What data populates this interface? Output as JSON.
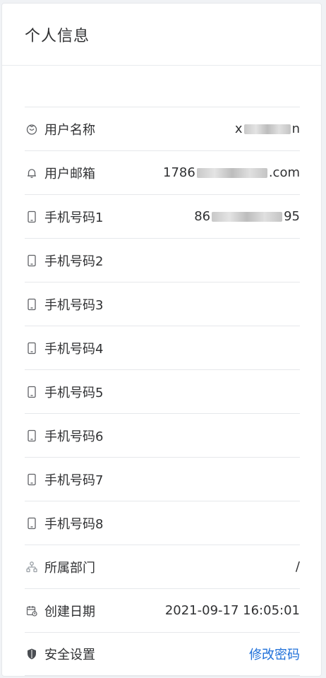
{
  "card": {
    "title": "个人信息"
  },
  "rows": [
    {
      "icon": "user-icon",
      "label": "用户名称",
      "value_prefix": "x",
      "value_suffix": "n"
    },
    {
      "icon": "bell-icon",
      "label": "用户邮箱",
      "value_prefix": "1786",
      "value_suffix": ".com"
    },
    {
      "icon": "phone-icon",
      "label": "手机号码1",
      "value_prefix": "86",
      "value_suffix": "95"
    },
    {
      "icon": "phone-icon",
      "label": "手机号码2",
      "value": ""
    },
    {
      "icon": "phone-icon",
      "label": "手机号码3",
      "value": ""
    },
    {
      "icon": "phone-icon",
      "label": "手机号码4",
      "value": ""
    },
    {
      "icon": "phone-icon",
      "label": "手机号码5",
      "value": ""
    },
    {
      "icon": "phone-icon",
      "label": "手机号码6",
      "value": ""
    },
    {
      "icon": "phone-icon",
      "label": "手机号码7",
      "value": ""
    },
    {
      "icon": "phone-icon",
      "label": "手机号码8",
      "value": ""
    },
    {
      "icon": "tree-icon",
      "label": "所属部门",
      "value": "/"
    },
    {
      "icon": "calendar-icon",
      "label": "创建日期",
      "value": "2021-09-17 16:05:01"
    },
    {
      "icon": "shield-icon",
      "label": "安全设置",
      "link": "修改密码"
    }
  ],
  "colors": {
    "link": "#1e6fd9",
    "text": "#303133",
    "icon": "#606266",
    "divider": "#e6e8eb"
  }
}
